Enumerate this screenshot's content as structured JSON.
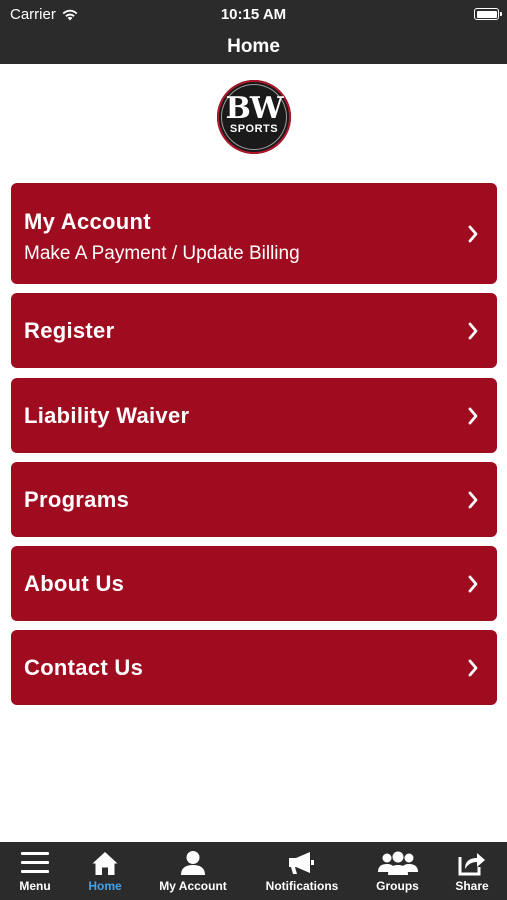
{
  "status_bar": {
    "carrier": "Carrier",
    "time": "10:15 AM"
  },
  "nav": {
    "title": "Home"
  },
  "logo": {
    "line1": "BW",
    "line2": "SPORTS"
  },
  "menu_items": [
    {
      "label": "My Account",
      "sublabel": "Make A Payment / Update Billing"
    },
    {
      "label": "Register"
    },
    {
      "label": "Liability Waiver"
    },
    {
      "label": "Programs"
    },
    {
      "label": "About Us"
    },
    {
      "label": "Contact Us"
    }
  ],
  "tabs": [
    {
      "label": "Menu",
      "icon": "hamburger-icon"
    },
    {
      "label": "Home",
      "icon": "home-icon",
      "active": true
    },
    {
      "label": "My Account",
      "icon": "user-icon"
    },
    {
      "label": "Notifications",
      "icon": "megaphone-icon"
    },
    {
      "label": "Groups",
      "icon": "groups-icon"
    },
    {
      "label": "Share",
      "icon": "share-icon"
    }
  ],
  "colors": {
    "bar_background": "#2b2b2b",
    "menu_item_background": "#a00c1f",
    "active_tab": "#3ea4ee"
  }
}
